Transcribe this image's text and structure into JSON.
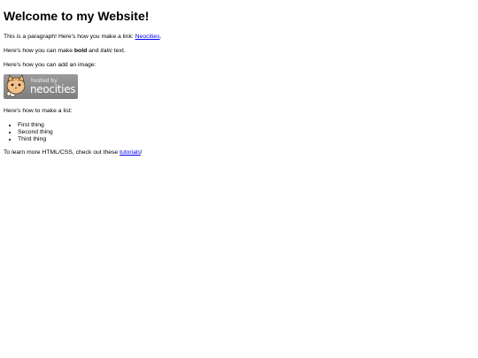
{
  "heading": "Welcome to my Website!",
  "para1": {
    "text_before": "This is a paragraph! Here's how you make a link: ",
    "link_text": "Neocities",
    "text_after": "."
  },
  "para2": {
    "text_before": "Here's how you can make ",
    "bold_text": "bold",
    "text_middle": " and ",
    "italic_text": "italic",
    "text_after": " text."
  },
  "para3": {
    "text": "Here's how you can add an image:"
  },
  "badge": {
    "line1": "hosted by",
    "line2": "neocities",
    "icon": "neocities-cat-mascot-icon"
  },
  "para4": {
    "text": "Here's how to make a list:"
  },
  "list": {
    "items": [
      "First thing",
      "Second thing",
      "Third thing"
    ]
  },
  "para5": {
    "text_before": "To learn more HTML/CSS, check out these ",
    "link_text": "tutorials",
    "text_after": "!"
  },
  "colors": {
    "link": "#0000ee",
    "text": "#000000",
    "background": "#ffffff",
    "badge_background": "#8a8a8a"
  }
}
